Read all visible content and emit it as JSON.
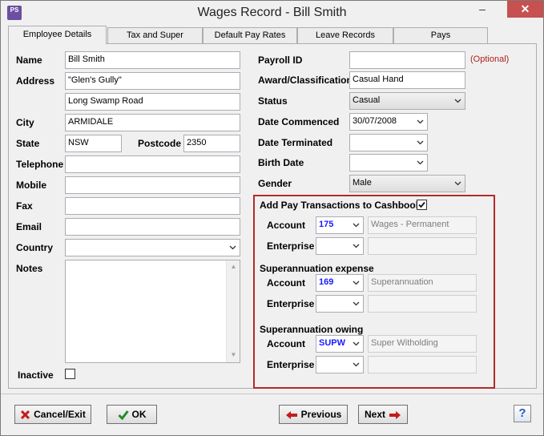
{
  "window": {
    "title": "Wages Record - Bill Smith",
    "app_icon_text": "PS"
  },
  "tabs": [
    "Employee Details",
    "Tax and Super",
    "Default Pay Rates",
    "Leave Records",
    "Pays"
  ],
  "left": {
    "name_label": "Name",
    "name_value": "Bill Smith",
    "address_label": "Address",
    "address_line1": "\"Glen's Gully\"",
    "address_line2": "Long Swamp Road",
    "city_label": "City",
    "city_value": "ARMIDALE",
    "state_label": "State",
    "state_value": "NSW",
    "postcode_label": "Postcode",
    "postcode_value": "2350",
    "telephone_label": "Telephone",
    "telephone_value": "",
    "mobile_label": "Mobile",
    "mobile_value": "",
    "fax_label": "Fax",
    "fax_value": "",
    "email_label": "Email",
    "email_value": "",
    "country_label": "Country",
    "country_value": "",
    "notes_label": "Notes",
    "notes_value": "",
    "inactive_label": "Inactive"
  },
  "right": {
    "payroll_label": "Payroll ID",
    "payroll_value": "",
    "payroll_hint": "(Optional)",
    "award_label": "Award/Classification",
    "award_value": "Casual Hand",
    "status_label": "Status",
    "status_value": "Casual",
    "commenced_label": "Date Commenced",
    "commenced_value": "30/07/2008",
    "terminated_label": "Date Terminated",
    "terminated_value": "",
    "birth_label": "Birth Date",
    "birth_value": "",
    "gender_label": "Gender",
    "gender_value": "Male"
  },
  "cashbook": {
    "add_label": "Add Pay Transactions to Cashbook",
    "add_checked": true,
    "account_label": "Account",
    "enterprise_label": "Enterprise",
    "wages_account": "175",
    "wages_desc": "Wages - Permanent",
    "super_expense_header": "Superannuation expense",
    "super_expense_account": "169",
    "super_expense_desc": "Superannuation",
    "super_owing_header": "Superannuation owing",
    "super_owing_account": "SUPW",
    "super_owing_desc": "Super Witholding"
  },
  "footer": {
    "cancel_label": "Cancel/Exit",
    "ok_label": "OK",
    "previous_label": "Previous",
    "next_label": "Next",
    "help_label": "?"
  }
}
